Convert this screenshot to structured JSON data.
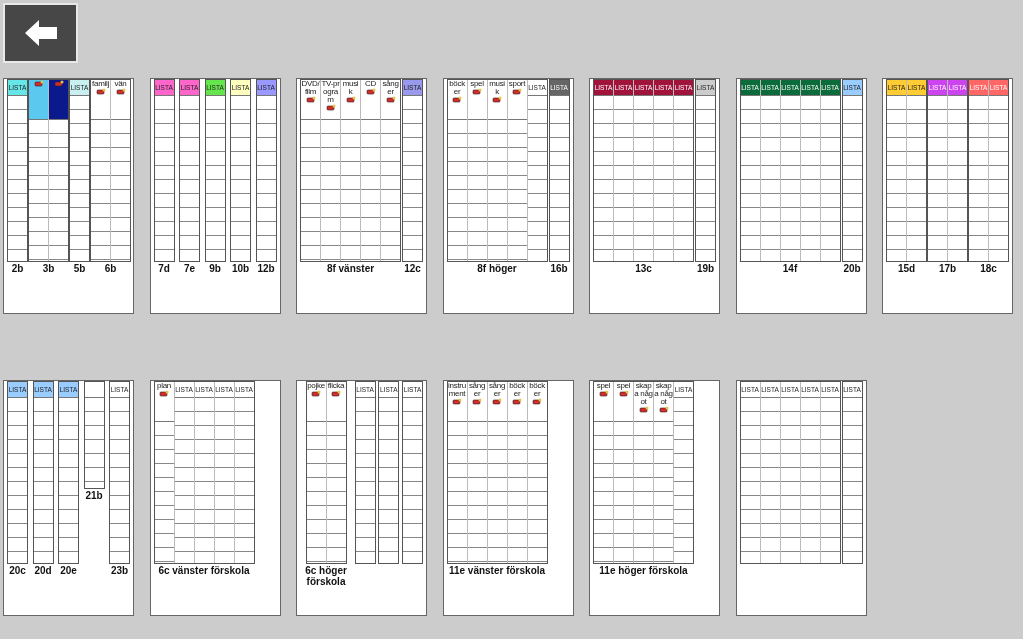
{
  "pages": [
    {
      "grids": [
        {
          "caption": "2b",
          "kind": "full",
          "columns": [
            {
              "kind": "lista",
              "header": "LISTA",
              "color": "#66e6e6"
            }
          ]
        },
        {
          "caption": "3b",
          "kind": "full",
          "columns": [
            {
              "kind": "symbol",
              "color": "#5bc8f0"
            },
            {
              "kind": "symbol",
              "color": "#0a1a8c"
            }
          ]
        },
        {
          "caption": "5b",
          "kind": "full",
          "columns": [
            {
              "kind": "lista",
              "header": "LISTA",
              "color": "#c8f0f0"
            }
          ]
        },
        {
          "caption": "6b",
          "kind": "full",
          "columns": [
            {
              "kind": "symbol",
              "header": "familj"
            },
            {
              "kind": "symbol",
              "header": "vän"
            }
          ]
        }
      ]
    },
    {
      "grids": [
        {
          "caption": "7d",
          "kind": "full",
          "columns": [
            {
              "kind": "lista",
              "header": "LISTA",
              "color": "#ff66cc"
            }
          ]
        },
        {
          "caption": "7e",
          "kind": "full",
          "columns": [
            {
              "kind": "lista",
              "header": "LISTA",
              "color": "#ff66cc"
            }
          ]
        },
        {
          "caption": "9b",
          "kind": "full",
          "columns": [
            {
              "kind": "lista",
              "header": "LISTA",
              "color": "#66e64d"
            }
          ]
        },
        {
          "caption": "10b",
          "kind": "full",
          "columns": [
            {
              "kind": "lista",
              "header": "LISTA",
              "color": "#ffffc0"
            }
          ]
        },
        {
          "caption": "12b",
          "kind": "full",
          "columns": [
            {
              "kind": "lista",
              "header": "LISTA",
              "color": "#9999ff"
            }
          ]
        }
      ]
    },
    {
      "grids": [
        {
          "caption": "8f vänster",
          "kind": "full",
          "columns": [
            {
              "kind": "symbol",
              "header": "DVD/film"
            },
            {
              "kind": "symbol",
              "header": "TV-program"
            },
            {
              "kind": "symbol",
              "header": "musik"
            },
            {
              "kind": "symbol",
              "header": "CD"
            },
            {
              "kind": "symbol",
              "header": "sånger"
            }
          ]
        },
        {
          "caption": "12c",
          "kind": "full",
          "columns": [
            {
              "kind": "lista",
              "header": "LISTA",
              "color": "#9999ee"
            }
          ]
        }
      ]
    },
    {
      "grids": [
        {
          "caption": "8f höger",
          "kind": "full",
          "columns": [
            {
              "kind": "symbol",
              "header": "böcker"
            },
            {
              "kind": "symbol",
              "header": "spel"
            },
            {
              "kind": "symbol",
              "header": "musik"
            },
            {
              "kind": "symbol",
              "header": "sport"
            },
            {
              "kind": "lista",
              "header": "LISTA"
            }
          ]
        },
        {
          "caption": "16b",
          "kind": "full",
          "columns": [
            {
              "kind": "lista",
              "header": "LISTA",
              "color": "#666666"
            }
          ]
        }
      ]
    },
    {
      "grids": [
        {
          "caption": "13c",
          "kind": "full",
          "columns": [
            {
              "kind": "lista",
              "header": "LISTA",
              "color": "#a0143c"
            },
            {
              "kind": "lista",
              "header": "LISTA",
              "color": "#a0143c"
            },
            {
              "kind": "lista",
              "header": "LISTA",
              "color": "#a0143c"
            },
            {
              "kind": "lista",
              "header": "LISTA",
              "color": "#a0143c"
            },
            {
              "kind": "lista",
              "header": "LISTA",
              "color": "#a0143c"
            }
          ]
        },
        {
          "caption": "19b",
          "kind": "full",
          "columns": [
            {
              "kind": "lista",
              "header": "LISTA",
              "color": "#cccccc"
            }
          ]
        }
      ]
    },
    {
      "grids": [
        {
          "caption": "14f",
          "kind": "full",
          "columns": [
            {
              "kind": "lista",
              "header": "LISTA",
              "color": "#0b6b3a"
            },
            {
              "kind": "lista",
              "header": "LISTA",
              "color": "#0b6b3a"
            },
            {
              "kind": "lista",
              "header": "LISTA",
              "color": "#0b6b3a"
            },
            {
              "kind": "lista",
              "header": "LISTA",
              "color": "#0b6b3a"
            },
            {
              "kind": "lista",
              "header": "LISTA",
              "color": "#0b6b3a"
            }
          ]
        },
        {
          "caption": "20b",
          "kind": "full",
          "columns": [
            {
              "kind": "lista",
              "header": "LISTA",
              "color": "#99ccff"
            }
          ]
        }
      ]
    },
    {
      "grids": [
        {
          "caption": "15d",
          "kind": "full",
          "columns": [
            {
              "kind": "lista",
              "header": "LISTA",
              "color": "#ffcc33"
            },
            {
              "kind": "lista",
              "header": "LISTA",
              "color": "#ffcc33"
            }
          ]
        },
        {
          "caption": "17b",
          "kind": "full",
          "columns": [
            {
              "kind": "lista",
              "header": "LISTA",
              "color": "#cc44ee"
            },
            {
              "kind": "lista",
              "header": "LISTA",
              "color": "#cc44ee"
            }
          ]
        },
        {
          "caption": "18c",
          "kind": "full",
          "columns": [
            {
              "kind": "lista",
              "header": "LISTA",
              "color": "#ff6666"
            },
            {
              "kind": "lista",
              "header": "LISTA",
              "color": "#ff6666"
            }
          ]
        }
      ]
    },
    {
      "grids": [
        {
          "caption": "20c",
          "kind": "full",
          "columns": [
            {
              "kind": "lista",
              "header": "LISTA",
              "color": "#99ccff"
            }
          ]
        },
        {
          "caption": "20d",
          "kind": "full",
          "columns": [
            {
              "kind": "lista",
              "header": "LISTA",
              "color": "#99ccff"
            }
          ]
        },
        {
          "caption": "20e",
          "kind": "full",
          "columns": [
            {
              "kind": "lista",
              "header": "LISTA",
              "color": "#99ccff"
            }
          ]
        },
        {
          "caption": "21b",
          "kind": "short",
          "columns": [
            {
              "kind": "blank"
            }
          ]
        },
        {
          "caption": "23b",
          "kind": "full",
          "columns": [
            {
              "kind": "lista",
              "header": "LISTA"
            }
          ]
        }
      ]
    },
    {
      "grids": [
        {
          "caption": "6c vänster förskola",
          "kind": "full",
          "columns": [
            {
              "kind": "symbol",
              "header": "plan"
            },
            {
              "kind": "lista",
              "header": "LISTA"
            },
            {
              "kind": "lista",
              "header": "LISTA"
            },
            {
              "kind": "lista",
              "header": "LISTA"
            },
            {
              "kind": "lista",
              "header": "LISTA"
            }
          ]
        }
      ]
    },
    {
      "grids": [
        {
          "caption": "6c höger förskola",
          "kind": "full",
          "columns": [
            {
              "kind": "symbol",
              "header": "pojke"
            },
            {
              "kind": "symbol",
              "header": "flicka"
            }
          ]
        },
        {
          "kind": "full",
          "columns": [
            {
              "kind": "lista",
              "header": "LISTA"
            }
          ]
        },
        {
          "kind": "full",
          "columns": [
            {
              "kind": "lista",
              "header": "LISTA"
            }
          ]
        },
        {
          "kind": "full",
          "columns": [
            {
              "kind": "lista",
              "header": "LISTA"
            }
          ]
        }
      ]
    },
    {
      "grids": [
        {
          "caption": "11e vänster förskola",
          "kind": "full",
          "columns": [
            {
              "kind": "symbol",
              "header": "instrument"
            },
            {
              "kind": "symbol",
              "header": "sånger"
            },
            {
              "kind": "symbol",
              "header": "sånger"
            },
            {
              "kind": "symbol",
              "header": "böcker"
            },
            {
              "kind": "symbol",
              "header": "böcker"
            }
          ]
        }
      ]
    },
    {
      "grids": [
        {
          "caption": "11e höger förskola",
          "kind": "full",
          "columns": [
            {
              "kind": "symbol",
              "header": "spel"
            },
            {
              "kind": "symbol",
              "header": "spel"
            },
            {
              "kind": "symbol",
              "header": "skapa något"
            },
            {
              "kind": "symbol",
              "header": "skapa något"
            },
            {
              "kind": "lista",
              "header": "LISTA"
            }
          ]
        }
      ]
    },
    {
      "grids": [
        {
          "kind": "full",
          "columns": [
            {
              "kind": "lista",
              "header": "LISTA"
            },
            {
              "kind": "lista",
              "header": "LISTA"
            },
            {
              "kind": "lista",
              "header": "LISTA"
            },
            {
              "kind": "lista",
              "header": "LISTA"
            },
            {
              "kind": "lista",
              "header": "LISTA"
            }
          ]
        },
        {
          "kind": "full",
          "columns": [
            {
              "kind": "lista",
              "header": "LISTA"
            }
          ]
        }
      ]
    }
  ]
}
